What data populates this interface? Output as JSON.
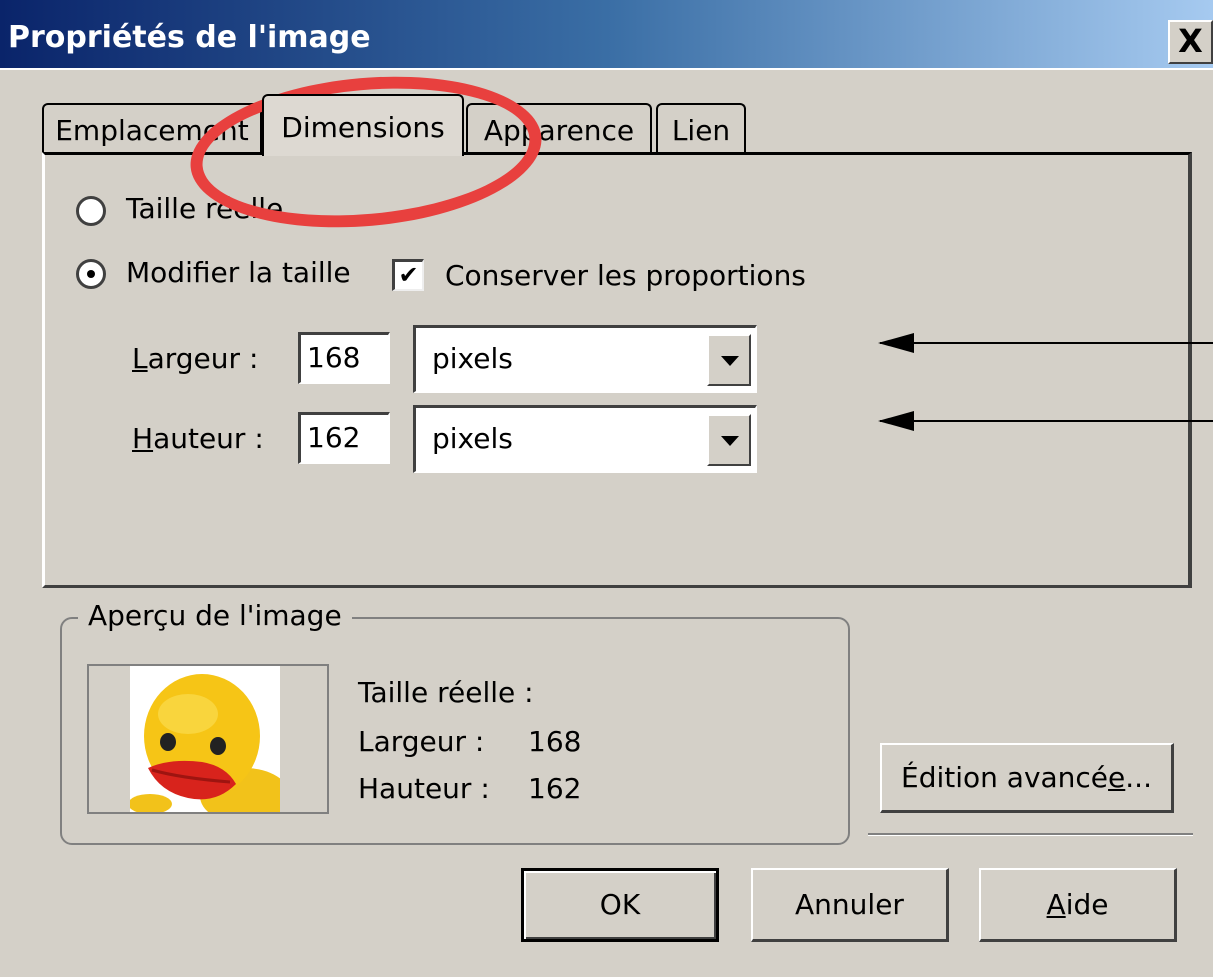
{
  "window": {
    "title": "Propriétés de l'image",
    "close_glyph": "X"
  },
  "tabs": [
    {
      "label": "Emplacement",
      "active": false
    },
    {
      "label": "Dimensions",
      "active": true
    },
    {
      "label": "Apparence",
      "active": false
    },
    {
      "label": "Lien",
      "active": false
    }
  ],
  "dimensions": {
    "radio_actual_size": {
      "label": "Taille réelle",
      "checked": false
    },
    "radio_custom_size": {
      "label": "Modifier la taille",
      "checked": true
    },
    "keep_ratio": {
      "label": "Conserver les proportions",
      "checked": true
    },
    "width": {
      "label_key": "L",
      "label_rest": "argeur :",
      "value": "168",
      "unit": "pixels"
    },
    "height": {
      "label_key": "H",
      "label_rest": "auteur :",
      "value": "162",
      "unit": "pixels"
    }
  },
  "preview": {
    "legend": "Aperçu de l'image",
    "actual_size_heading": "Taille réelle :",
    "width_label": "Largeur :",
    "width_value": "168",
    "height_label": "Hauteur :",
    "height_value": "162",
    "image_subject": "rubber-duck"
  },
  "buttons": {
    "advanced_edit_prefix": "Édition avancé",
    "advanced_edit_key": "e",
    "advanced_edit_suffix": "...",
    "ok": "OK",
    "cancel": "Annuler",
    "help_key": "A",
    "help_rest": "ide"
  },
  "annotation": {
    "color": "#e8403e",
    "arrow_color": "#000000"
  }
}
